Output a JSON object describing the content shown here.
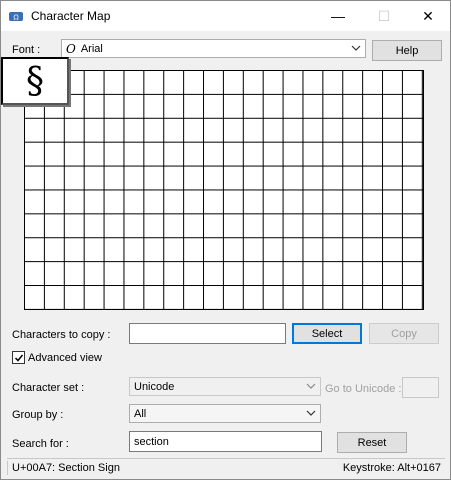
{
  "window": {
    "title": "Character Map",
    "controls": {
      "minimize": "—",
      "maximize": "☐",
      "close": "✕"
    }
  },
  "font_row": {
    "label": "Font :",
    "font_icon": "O",
    "font_value": "Arial",
    "help_label": "Help"
  },
  "grid": {
    "enlarged_char": "§",
    "rows": 10,
    "columns": 20
  },
  "copy_row": {
    "label": "Characters to copy :",
    "value": "",
    "select_label": "Select",
    "copy_label": "Copy"
  },
  "advanced": {
    "label": "Advanced view",
    "checked": true
  },
  "character_set": {
    "label": "Character set :",
    "value": "Unicode",
    "goto_label": "Go to Unicode :",
    "goto_value": ""
  },
  "group_by": {
    "label": "Group by :",
    "value": "All"
  },
  "search": {
    "label": "Search for :",
    "value": "section",
    "reset_label": "Reset"
  },
  "status": {
    "left": "U+00A7: Section Sign",
    "right": "Keystroke: Alt+0167"
  }
}
